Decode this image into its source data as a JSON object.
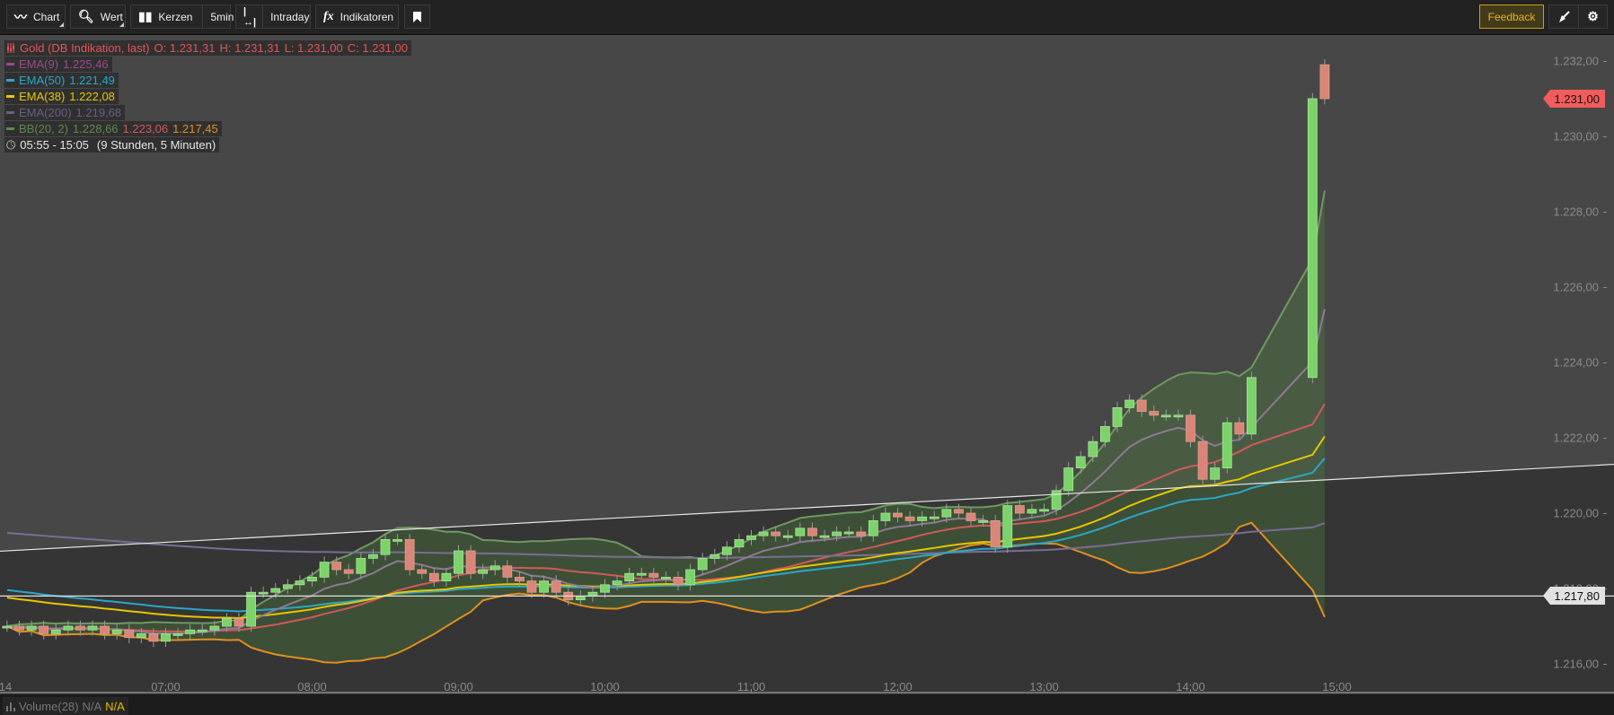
{
  "toolbar": {
    "chart": {
      "label": "Chart",
      "icon": "line-chart-icon"
    },
    "wert": {
      "label": "Wert",
      "icon": "search-icon"
    },
    "kerzen": {
      "label": "Kerzen",
      "icon": "candlestick-icon"
    },
    "interval": "5min",
    "range": {
      "label": "Intraday",
      "icon": "range-icon"
    },
    "indikatoren": {
      "label": "Indikatoren",
      "icon": "fx-icon"
    },
    "bookmark": {
      "icon": "bookmark-icon"
    },
    "feedback": "Feedback",
    "broom": {
      "icon": "broom-icon"
    },
    "settings": {
      "icon": "gear-icon"
    }
  },
  "legend": {
    "instrument": {
      "name": "Gold (DB Indikation, last)",
      "o": "O: 1.231,31",
      "h": "H: 1.231,31",
      "l": "L: 1.231,00",
      "c": "C: 1.231,00",
      "color": "#e25656"
    },
    "ema9": {
      "label": "EMA(9)",
      "value": "1.225,46",
      "color": "#9c4b8d"
    },
    "ema50": {
      "label": "EMA(50)",
      "value": "1.221,49",
      "color": "#2aa7c6"
    },
    "ema38": {
      "label": "EMA(38)",
      "value": "1.222,08",
      "color": "#e6c600"
    },
    "ema200": {
      "label": "EMA(200)",
      "value": "1.219,68",
      "color": "#6b5f86"
    },
    "bb": {
      "label": "BB(20, 2)",
      "upper": "1.228,66",
      "middle": "1.223,06",
      "lower": "1.217,45",
      "color": "#5e8a4e",
      "middle_color": "#d05a5a",
      "lower_color": "#e0901e"
    },
    "timerange": "05:55 - 15:05",
    "duration": "(9 Stunden, 5 Minuten)"
  },
  "price_axis": {
    "labels": [
      "1.216,00",
      "1.218,00",
      "1.220,00",
      "1.222,00",
      "1.224,00",
      "1.226,00",
      "1.228,00",
      "1.230,00",
      "1.232,00"
    ],
    "last_price_tag": "1.231,00",
    "last_price_color": "#f25c5c",
    "line_tag": "1.217,80"
  },
  "time_axis": {
    "labels": [
      "14",
      "07:00",
      "08:00",
      "09:00",
      "10:00",
      "11:00",
      "12:00",
      "13:00",
      "14:00",
      "15:00"
    ]
  },
  "volume": {
    "label": "Volume(28)",
    "value1": "N/A",
    "value2": "N/A"
  },
  "chart_data": {
    "type": "candlestick",
    "instrument": "Gold (DB Indikation, last)",
    "interval": "5min",
    "start": "05:55",
    "ylim": [
      1215.5,
      1232.5
    ],
    "horizontal_line": 1217.8,
    "trendline": [
      [
        "05:55",
        1219.0
      ],
      [
        "15:00",
        1220.9
      ]
    ],
    "first_open": 1217.0,
    "open_overrides": {
      "14:00": 1222.6,
      "14:55": 1231.9,
      "15:00": 1231.3
    },
    "closes": [
      1217.0,
      1216.9,
      1217.0,
      1216.8,
      1216.9,
      1217.0,
      1216.9,
      1217.0,
      1216.8,
      1216.9,
      1216.7,
      1216.8,
      1216.6,
      1216.8,
      1216.8,
      1216.9,
      1216.9,
      1217.0,
      1217.2,
      1217.0,
      1217.9,
      1217.9,
      1218.0,
      1218.1,
      1218.2,
      1218.3,
      1218.7,
      1218.5,
      1218.4,
      1218.8,
      1218.9,
      1219.3,
      1219.3,
      1218.5,
      1218.4,
      1218.2,
      1218.4,
      1219.0,
      1218.4,
      1218.5,
      1218.6,
      1218.3,
      1218.2,
      1217.9,
      1218.2,
      1217.9,
      1217.7,
      1217.8,
      1217.9,
      1218.1,
      1218.2,
      1218.4,
      1218.4,
      1218.3,
      1218.3,
      1218.1,
      1218.5,
      1218.8,
      1218.9,
      1219.1,
      1219.3,
      1219.4,
      1219.5,
      1219.4,
      1219.4,
      1219.6,
      1219.4,
      1219.4,
      1219.5,
      1219.5,
      1219.4,
      1219.8,
      1220.0,
      1219.9,
      1219.8,
      1219.9,
      1219.9,
      1220.1,
      1220.0,
      1219.8,
      1219.8,
      1219.1,
      1220.2,
      1220.0,
      1220.1,
      1220.1,
      1220.6,
      1221.2,
      1221.5,
      1221.9,
      1222.3,
      1222.8,
      1223.0,
      1222.7,
      1222.6,
      1222.6,
      1222.6,
      1221.9,
      1220.9,
      1221.2,
      1222.4,
      1222.1,
      1223.6,
      null,
      null,
      null,
      null,
      1231.0,
      1231.0
    ]
  }
}
